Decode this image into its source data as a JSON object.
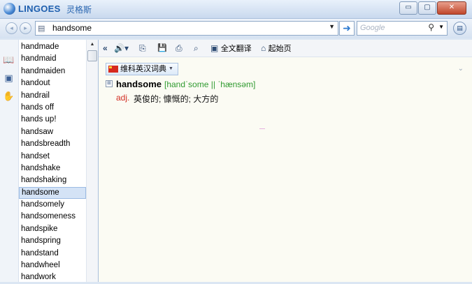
{
  "window": {
    "app_name": "LINGOES",
    "app_name_cn": "灵格斯",
    "controls": {
      "minimize_glyph": "▭",
      "maximize_glyph": "▢",
      "close_glyph": "✕"
    }
  },
  "navbar": {
    "back_glyph": "◂",
    "forward_glyph": "▸",
    "dict_icon_glyph": "▤",
    "search_value": "handsome",
    "dropdown_glyph": "▼",
    "go_glyph": "➜",
    "google_placeholder": "Google",
    "search_icon_glyph": "⚲",
    "menu_glyph": "▤"
  },
  "sidebar": {
    "rail_icons": [
      "book-icon",
      "dictionary-icon",
      "handshake-icon"
    ],
    "words": [
      "handmade",
      "handmaid",
      "handmaiden",
      "handout",
      "handrail",
      "hands off",
      "hands up!",
      "handsaw",
      "handsbreadth",
      "handset",
      "handshake",
      "handshaking",
      "handsome",
      "handsomely",
      "handsomeness",
      "handspike",
      "handspring",
      "handstand",
      "handwheel",
      "handwork"
    ],
    "selected_index": 12,
    "scroll_up_glyph": "▲"
  },
  "toolbar": {
    "collapse_glyph": "«",
    "speaker_glyph": "🔊▾",
    "copy_glyph": "⎘",
    "save_glyph": "💾",
    "print_glyph": "⎙",
    "find_glyph": "⌕",
    "translate_label": "全文翻译",
    "home_label": "起始页"
  },
  "result": {
    "dictionary_tab": "维科英汉词典",
    "tab_dd_glyph": "▼",
    "collapse_chevron": "⌄",
    "expand_glyph": "⊞",
    "headword": "handsome",
    "phonetic": "[handˈsome || ˈhænsəm]",
    "pos": "adj.",
    "meaning": "英俊的; 慷慨的; 大方的"
  },
  "colors": {
    "accent": "#2e7bd1",
    "phonetic": "#2f9a2f",
    "part_of_speech": "#d22d22",
    "selection": "#d4e3f6"
  }
}
